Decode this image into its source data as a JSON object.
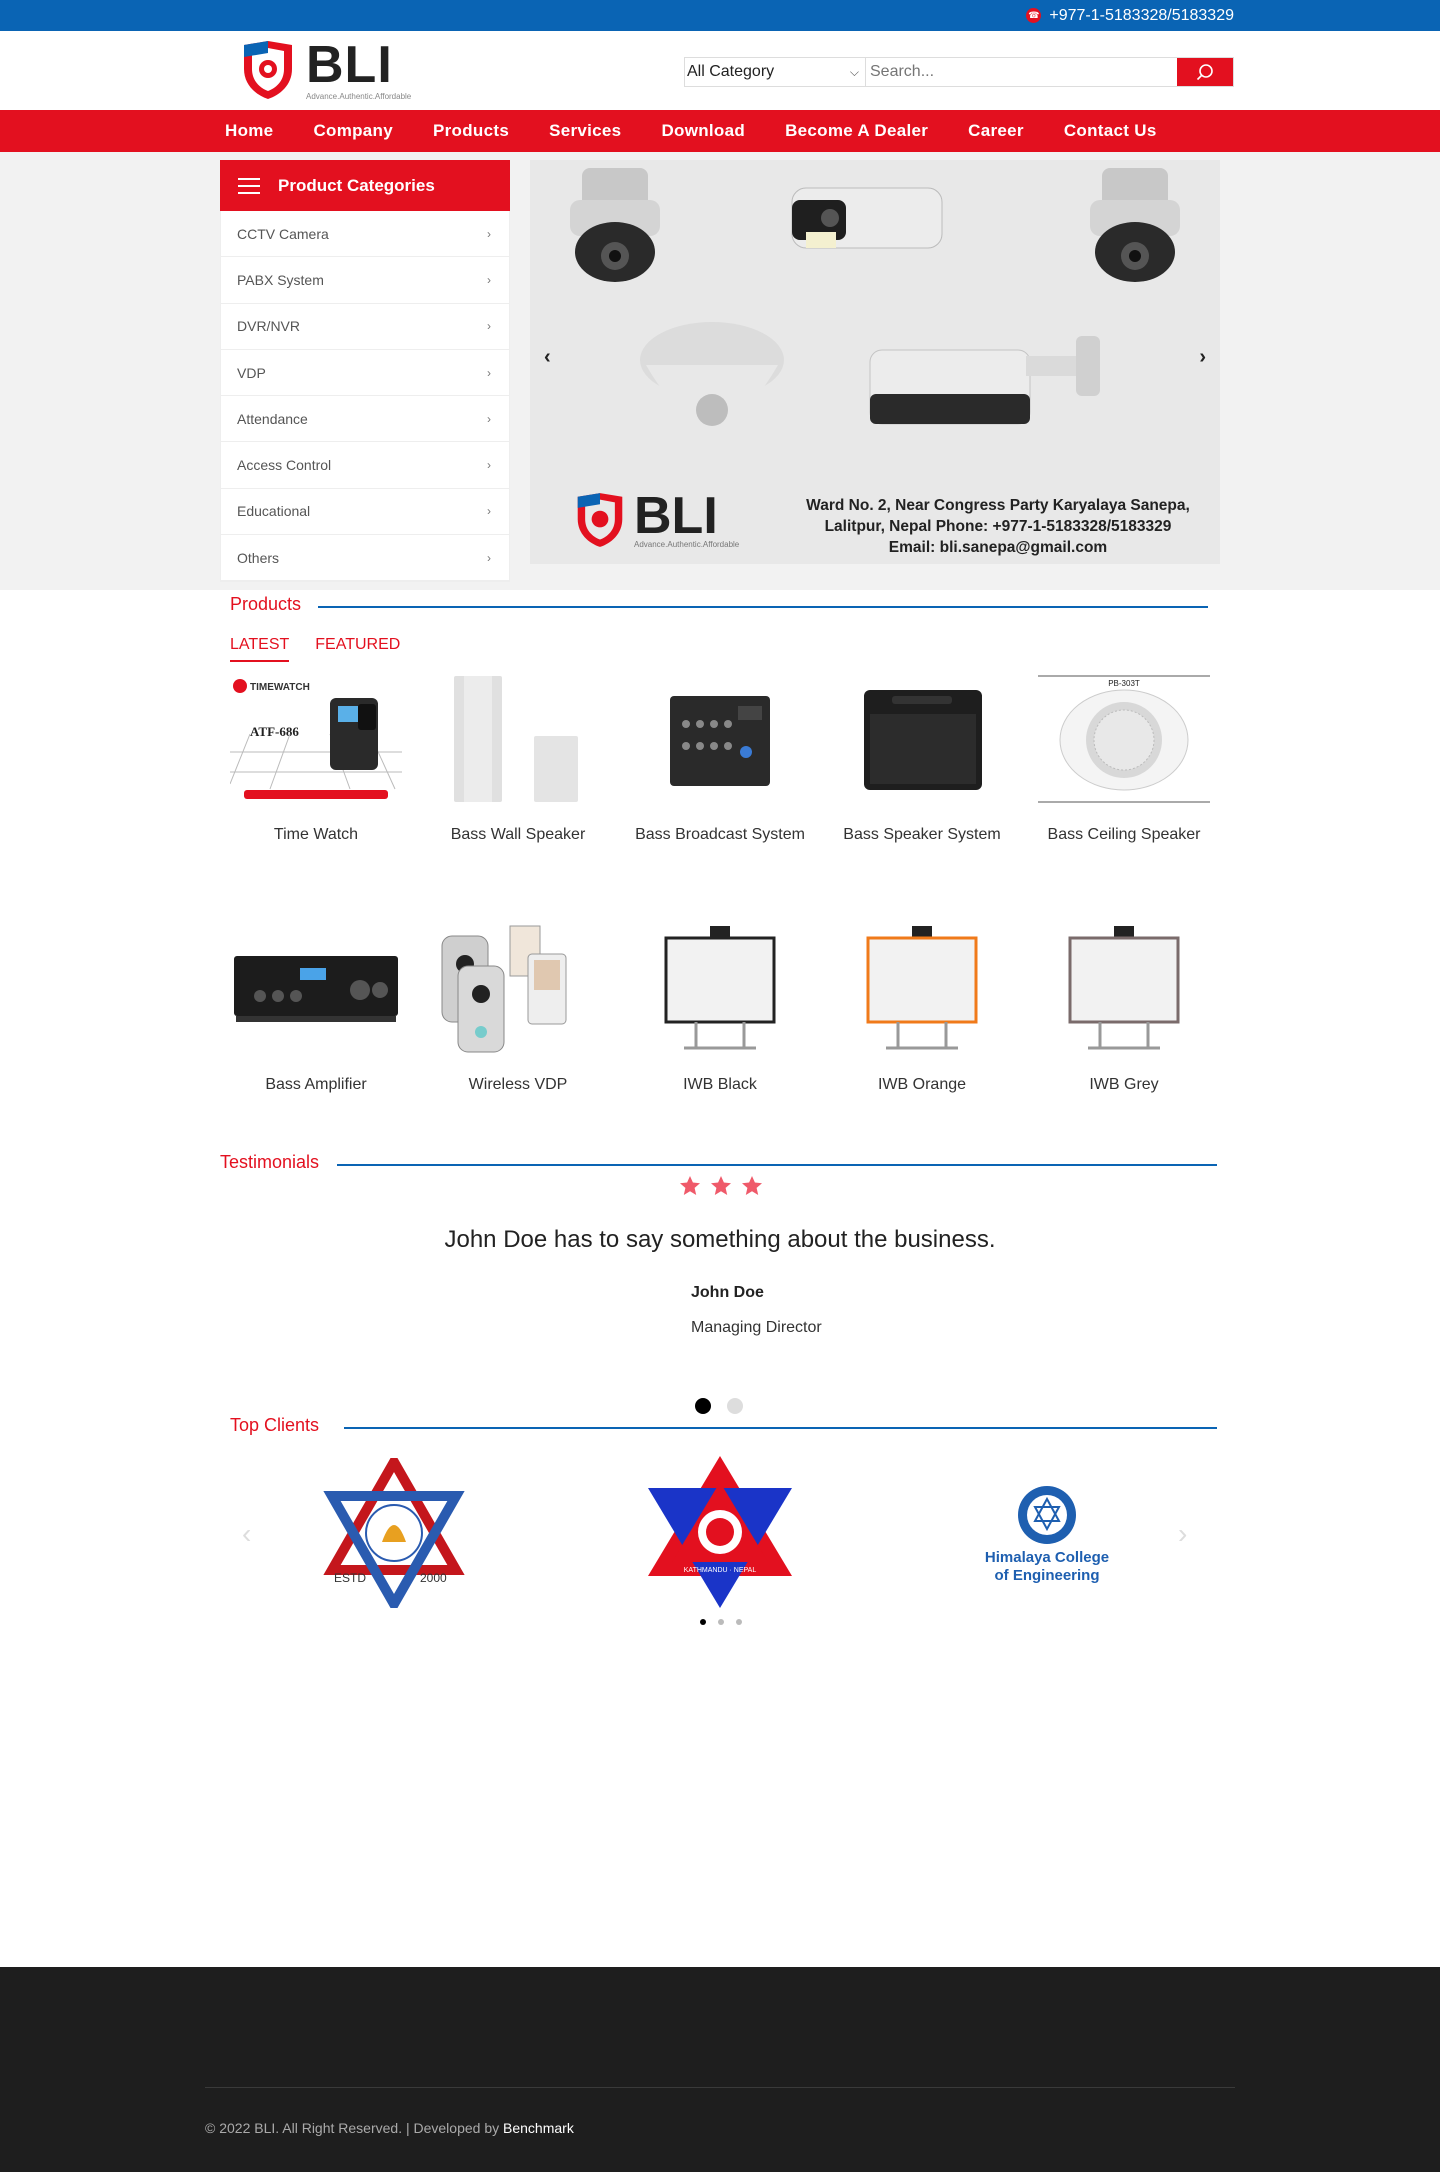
{
  "topbar": {
    "phone": "+977-1-5183328/5183329"
  },
  "header": {
    "brand": "BLI",
    "tagline": "Advance.Authentic.Affordable",
    "search": {
      "category": "All Category",
      "placeholder": "Search..."
    }
  },
  "nav": [
    "Home",
    "Company",
    "Products",
    "Services",
    "Download",
    "Become A Dealer",
    "Career",
    "Contact Us"
  ],
  "categories": {
    "title": "Product Categories",
    "items": [
      "CCTV Camera",
      "PABX System",
      "DVR/NVR",
      "VDP",
      "Attendance",
      "Access Control",
      "Educational",
      "Others"
    ]
  },
  "slider": {
    "brand": "BLI",
    "tagline": "Advance.Authentic.Affordable",
    "address_line1": "Ward No. 2, Near Congress Party Karyalaya Sanepa,",
    "address_line2": "Lalitpur, Nepal Phone: +977-1-5183328/5183329",
    "address_line3": "Email: bli.sanepa@gmail.com"
  },
  "products": {
    "title": "Products",
    "tabs": [
      "LATEST",
      "FEATURED"
    ],
    "items": [
      {
        "name": "Time Watch",
        "badge": "TIMEWATCH",
        "model": "ATF-686"
      },
      {
        "name": "Bass Wall Speaker"
      },
      {
        "name": "Bass Broadcast System"
      },
      {
        "name": "Bass Speaker System"
      },
      {
        "name": "Bass Ceiling Speaker",
        "model": "PB-303T"
      },
      {
        "name": "Bass Amplifier"
      },
      {
        "name": "Wireless VDP"
      },
      {
        "name": "IWB Black"
      },
      {
        "name": "IWB Orange"
      },
      {
        "name": "IWB Grey"
      }
    ]
  },
  "testimonials": {
    "title": "Testimonials",
    "rating": 3,
    "quote": "John Doe has to say something about the business.",
    "name": "John Doe",
    "role": "Managing Director"
  },
  "clients": {
    "title": "Top Clients",
    "items": [
      {
        "caption_left": "ESTD",
        "caption_right": "2000"
      },
      {
        "caption": "KATHMANDU · NEPAL"
      },
      {
        "line1": "Himalaya College",
        "line2": "of Engineering"
      }
    ]
  },
  "footer": {
    "copyright": "© 2022 BLI. All Right Reserved. | Developed by ",
    "developer": "Benchmark"
  },
  "colors": {
    "brand_red": "#e3101f",
    "brand_blue": "#0a64b4",
    "footer_bg": "#1e1e1e"
  }
}
